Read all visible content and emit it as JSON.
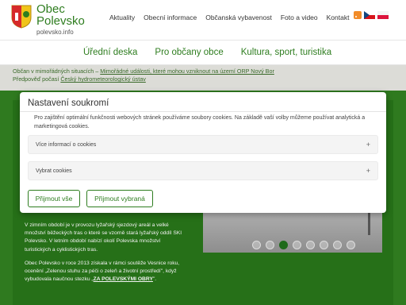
{
  "brand": {
    "line1": "Obec",
    "line2": "Polevsko",
    "url": "polevsko.info"
  },
  "topnav": [
    "Aktuality",
    "Obecní informace",
    "Občanská vybavenost",
    "Foto a video",
    "Kontakt"
  ],
  "mainmenu": [
    "Úřední deska",
    "Pro občany obce",
    "Kultura, sport, turistika"
  ],
  "infostrip": {
    "row1_prefix": "Občan v mimořádných situacích – ",
    "row1_link": "Mimořádné události, které mohou vzniknout na území ORP Nový Bor",
    "row2_prefix": "Předpověď počasí ",
    "row2_link": "Český hydrometeorologický ústav"
  },
  "content": {
    "para1": "V zimním období je v provozu lyžařský sjezdový areál a velké množství běžeckých tras o které se vzorně stará lyžařský oddíl SKI Polevsko. V letním období nabízí okolí Polevska množství turistických a cyklistických tras.",
    "para2_prefix": "Obec Polevsko v roce 2013 získala v rámci soutěže Vesnice roku, ocenění „Zelenou stuhu za péči o zeleň a životní prostředí\", když vybudovala naučnou stezku „",
    "para2_link": "ZA POLEVSKÝMI OBRY",
    "para2_suffix": "\"."
  },
  "slider": {
    "dot_count": 8,
    "active_index": 2
  },
  "modal": {
    "title": "Nastavení soukromí",
    "description": "Pro zajištění optimální funkčnosti webových stránek používáme soubory cookies. Na základě vaší volby můžeme používat analytická a marketingová cookies.",
    "accordion1": "Více informací o cookies",
    "accordion2": "Vybrat cookies",
    "accordion_icon": "+",
    "accept_all": "Přijmout vše",
    "accept_selected": "Přijmout vybraná"
  },
  "colors": {
    "brand_green": "#2e7d1f",
    "content_green": "#2f7a1f",
    "strip_gray": "#dcdcd7"
  },
  "icons": [
    "coat-of-arms-icon",
    "rss-icon",
    "czech-flag-icon",
    "polish-flag-icon"
  ]
}
